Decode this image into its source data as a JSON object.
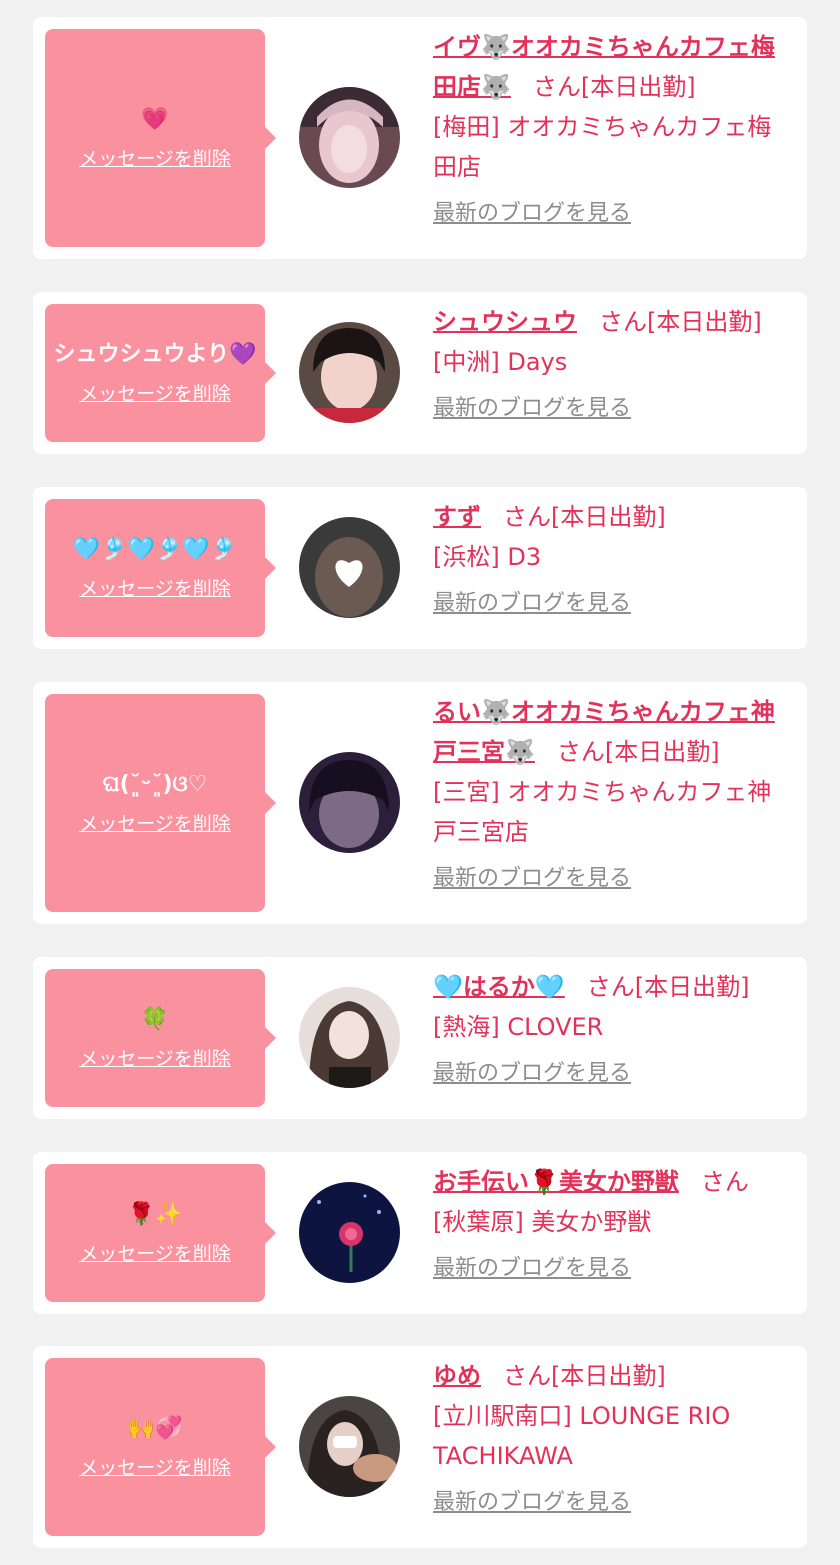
{
  "delete_label": "メッセージを削除",
  "blog_label": "最新のブログを見る",
  "colors": {
    "accent": "#e3325a",
    "message_bg": "#fa919f",
    "muted": "#8d8d8d",
    "page_bg": "#f1f1f1"
  },
  "cards": [
    {
      "message": "💗",
      "name": "イヴ🐺オオカミちゃんカフェ梅田店🐺",
      "suffix": "さん[本日出勤]",
      "shop": "[梅田] オオカミちゃんカフェ梅田店"
    },
    {
      "message": "シュウシュウより💜",
      "name": "シュウシュウ",
      "suffix": "さん[本日出勤]",
      "shop": "[中洲] Days"
    },
    {
      "message": "🩵🎐🩵🎐🩵🎐",
      "name": "すず",
      "suffix": "さん[本日出勤]",
      "shop": "[浜松] D3"
    },
    {
      "message": "ଘ(˘͈ᵕ˘͈)ଓ♡",
      "name": "るい🐺オオカミちゃんカフェ神戸三宮🐺",
      "suffix": "さん[本日出勤]",
      "shop": "[三宮] オオカミちゃんカフェ神戸三宮店"
    },
    {
      "message": "🍀",
      "name": "🩵はるか🩵",
      "suffix": "さん[本日出勤]",
      "shop": "[熱海] CLOVER"
    },
    {
      "message": "🌹✨",
      "name": "お手伝い🌹美女か野獣",
      "suffix": "さん",
      "shop": "[秋葉原] 美女か野獣"
    },
    {
      "message": "🙌💞",
      "name": "ゆめ",
      "suffix": "さん[本日出勤]",
      "shop": "[立川駅南口] LOUNGE RIO TACHIKAWA"
    }
  ]
}
